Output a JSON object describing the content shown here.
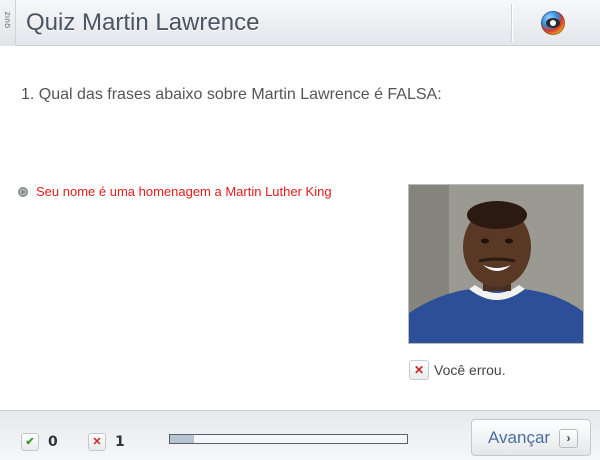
{
  "header": {
    "tag": "QUIZ",
    "title": "Quiz Martin Lawrence",
    "logo_icon": "globo-logo"
  },
  "question": {
    "text": "1. Qual das frases abaixo sobre Martin Lawrence é FALSA:"
  },
  "options": [
    {
      "label": "Seu nome é uma homenagem a Martin Luther King",
      "state": "incorrect",
      "color": "#e21b1b"
    }
  ],
  "feedback": {
    "icon": "x-mark-icon",
    "text": "Você errou."
  },
  "footer": {
    "correct_count": "0",
    "wrong_count": "1",
    "progress_fraction": 0.1,
    "next_label": "Avançar",
    "next_icon": "chevron-right-icon"
  },
  "colors": {
    "wrong": "#d52020",
    "correct": "#3a9a2a",
    "title": "#4a5563",
    "link_blue": "#4a6fa0"
  }
}
